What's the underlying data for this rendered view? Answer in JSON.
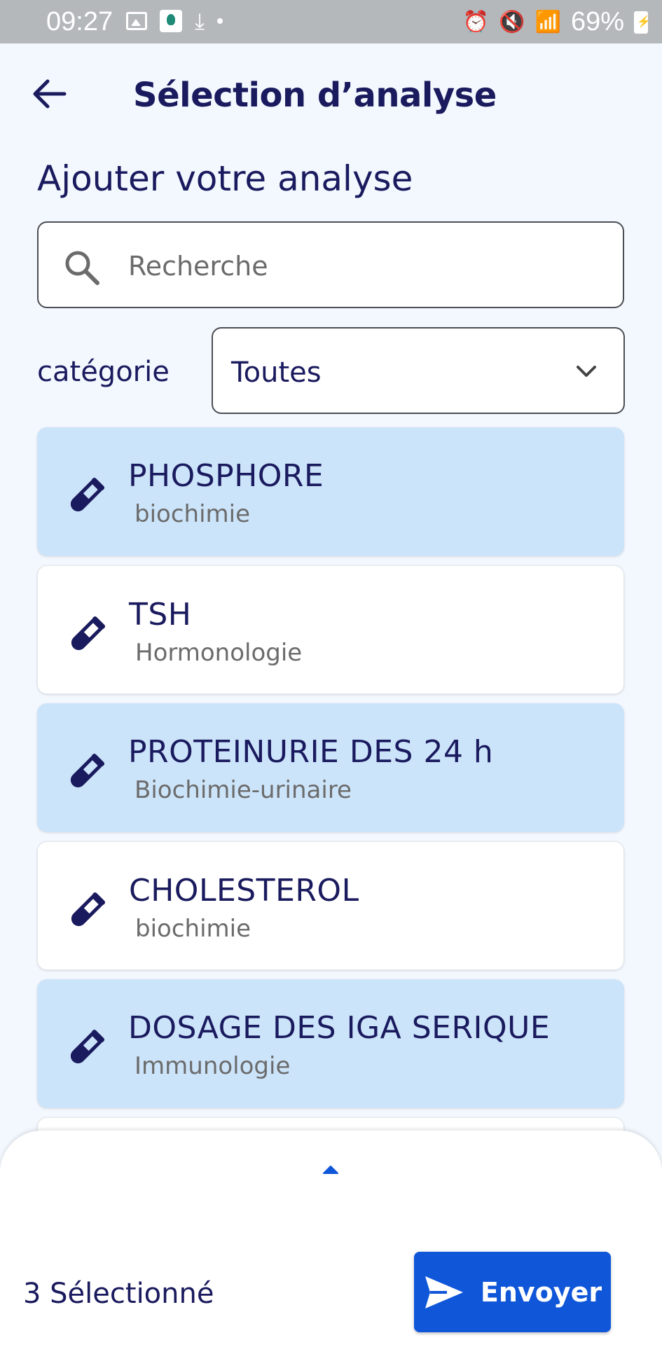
{
  "status_bar": {
    "time": "09:27",
    "battery": "69%"
  },
  "header": {
    "title": "Sélection d’analyse"
  },
  "section": {
    "title": "Ajouter votre analyse"
  },
  "search": {
    "placeholder": "Recherche",
    "value": ""
  },
  "filter": {
    "label": "catégorie",
    "selected": "Toutes"
  },
  "analyses": [
    {
      "name": "PHOSPHORE",
      "category": "biochimie",
      "selected": true
    },
    {
      "name": "TSH",
      "category": "Hormonologie",
      "selected": false
    },
    {
      "name": "PROTEINURIE DES 24 h",
      "category": "Biochimie-urinaire",
      "selected": true
    },
    {
      "name": "CHOLESTEROL",
      "category": "biochimie",
      "selected": false
    },
    {
      "name": "DOSAGE DES IGA SERIQUE",
      "category": "Immunologie",
      "selected": true
    }
  ],
  "footer": {
    "selected_count": "3 Sélectionné",
    "send_label": "Envoyer"
  },
  "colors": {
    "background": "#f3f8fe",
    "selected_item": "#cce4fa",
    "primary": "#0f56d9",
    "text_dark": "#1a1a5e"
  },
  "icons": {
    "back": "arrow-left-icon",
    "search": "search-icon",
    "dropdown": "chevron-down-icon",
    "analysis": "test-tube-icon",
    "send": "send-icon"
  }
}
